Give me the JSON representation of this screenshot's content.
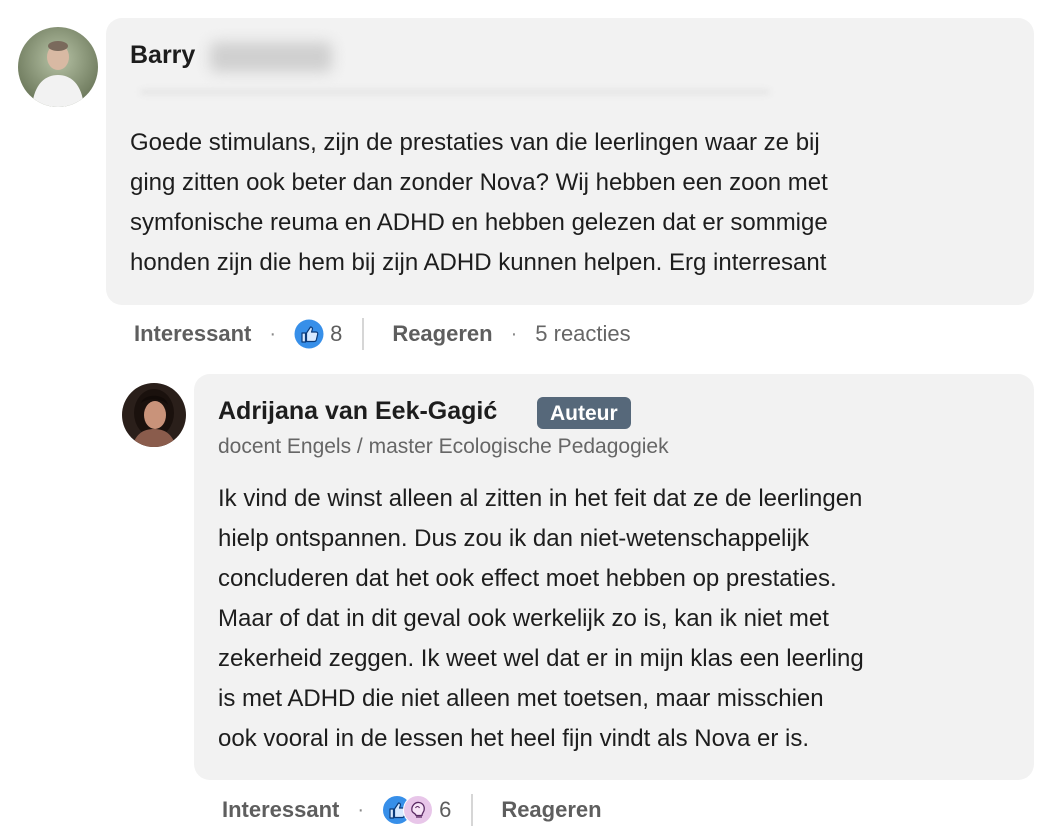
{
  "comment": {
    "author_name": "Barry",
    "text": "Goede stimulans, zijn de prestaties van die leerlingen waar ze bij\nging zitten ook beter dan zonder Nova? Wij hebben een zoon met\nsymfonische reuma en ADHD en hebben gelezen dat er sommige\nhonden zijn die hem bij zijn ADHD kunnen helpen. Erg interresant",
    "actions": {
      "react_label": "Interessant",
      "reaction_icons": [
        "like-icon"
      ],
      "reaction_count": "8",
      "reply_label": "Reageren",
      "replies_text": "5 reacties"
    }
  },
  "reply": {
    "author_name": "Adrijana van Eek-Gagić",
    "badge": "Auteur",
    "headline": "docent Engels / master Ecologische Pedagogiek",
    "text": "Ik vind de winst alleen al zitten in het feit dat ze de leerlingen\nhielp ontspannen. Dus zou ik dan niet-wetenschappelijk\nconcluderen dat het ook effect moet hebben op prestaties.\nMaar of dat in dit geval ook werkelijk zo is, kan ik niet met\nzekerheid zeggen. Ik weet wel dat er in mijn klas een leerling\nis met ADHD die niet alleen met toetsen, maar misschien\nook vooral in de lessen het heel fijn vindt als Nova er is.",
    "actions": {
      "react_label": "Interessant",
      "reaction_icons": [
        "like-icon",
        "insightful-icon"
      ],
      "reaction_count": "6",
      "reply_label": "Reageren"
    }
  },
  "colors": {
    "bubble": "#f2f2f2",
    "badge": "#56687a",
    "like_blue": "#378fe9",
    "insightful_pink": "#e8c6e9"
  }
}
